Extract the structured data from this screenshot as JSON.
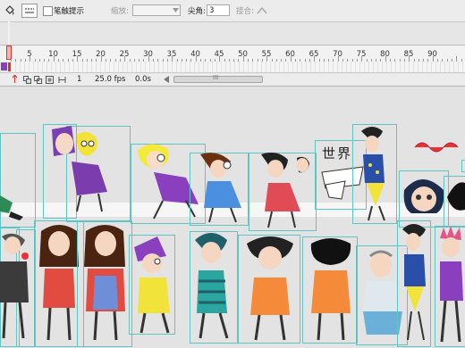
{
  "properties_bar": {
    "snap_hint_label": "笔触提示",
    "scale_label": "缩放:",
    "scale_value": "",
    "corner_label": "尖角:",
    "corner_value": "3",
    "join_label": "接合:"
  },
  "timeline": {
    "frame_numbers": [
      "5",
      "10",
      "15",
      "20",
      "25",
      "30",
      "35",
      "40",
      "45",
      "50",
      "55",
      "60",
      "65",
      "70",
      "75",
      "80",
      "85",
      "90"
    ],
    "current_frame": "1",
    "fps": "25.0 fps",
    "elapsed": "0.0s",
    "scroll_grip": "III"
  },
  "stage": {
    "world_sign_text": "世界"
  },
  "colors": {
    "selection_box": "#5fc4c4",
    "playhead": "#d9342b",
    "stage_bg": "#e3e3e3"
  }
}
